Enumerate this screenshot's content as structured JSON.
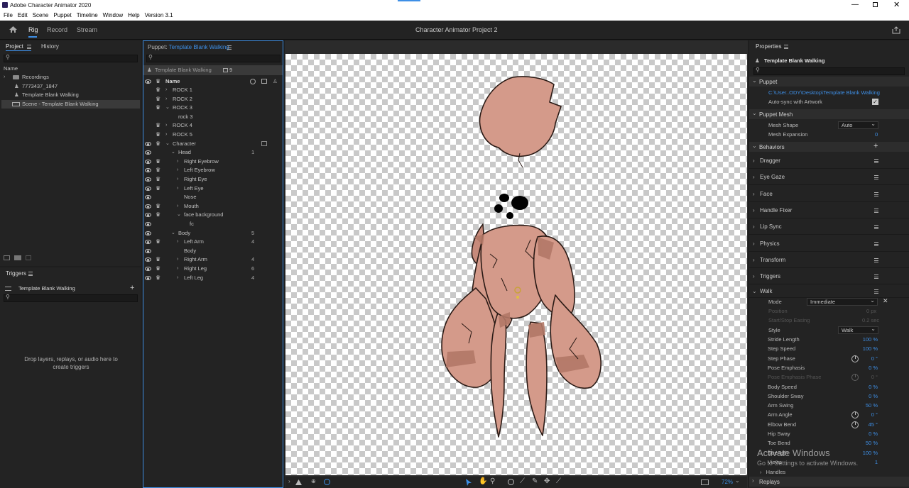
{
  "app": {
    "title": "Adobe Character Animator 2020",
    "project": "Character Animator Project 2"
  },
  "menu": [
    "File",
    "Edit",
    "Scene",
    "Puppet",
    "Timeline",
    "Window",
    "Help",
    "Version 3.1"
  ],
  "workspace": {
    "tabs": [
      "Rig",
      "Record",
      "Stream"
    ],
    "active": "Rig"
  },
  "project_panel": {
    "tabs": [
      "Project",
      "History"
    ],
    "column": "Name",
    "items": [
      "Recordings",
      "7773437_1847",
      "Template Blank Walking",
      "Scene - Template Blank Walking"
    ]
  },
  "triggers_panel": {
    "title": "Triggers",
    "puppet": "Template Blank Walking",
    "empty_text": "Drop layers, replays, or audio here to create triggers"
  },
  "puppet_panel": {
    "label": "Puppet:",
    "name": "Template Blank Walking",
    "puppet_row": "Template Blank Walking",
    "puppet_count": "9",
    "column": "Name",
    "layers": [
      {
        "name": "ROCK 1",
        "count": ""
      },
      {
        "name": "ROCK 2",
        "count": ""
      },
      {
        "name": "ROCK 3",
        "count": ""
      },
      {
        "name": "rock 3",
        "count": ""
      },
      {
        "name": "ROCK 4",
        "count": ""
      },
      {
        "name": "ROCK 5",
        "count": ""
      },
      {
        "name": "Character",
        "count": ""
      },
      {
        "name": "Head",
        "count": "1"
      },
      {
        "name": "Right Eyebrow",
        "count": ""
      },
      {
        "name": "Left Eyebrow",
        "count": ""
      },
      {
        "name": "Right Eye",
        "count": ""
      },
      {
        "name": "Left Eye",
        "count": ""
      },
      {
        "name": "Nose",
        "count": ""
      },
      {
        "name": "Mouth",
        "count": ""
      },
      {
        "name": "face background",
        "count": ""
      },
      {
        "name": "fc",
        "count": ""
      },
      {
        "name": "Body",
        "count": "5"
      },
      {
        "name": "Left Arm",
        "count": "4"
      },
      {
        "name": "Body",
        "count": ""
      },
      {
        "name": "Right Arm",
        "count": "4"
      },
      {
        "name": "Right Leg",
        "count": "6"
      },
      {
        "name": "Left Leg",
        "count": "4"
      }
    ]
  },
  "stage": {
    "zoom": "72%"
  },
  "properties": {
    "title": "Properties",
    "puppet_name": "Template Blank Walking",
    "puppet_section": "Puppet",
    "path": "C:\\User..ODY\\Desktop\\Template Blank Walking",
    "autosync_label": "Auto-sync with Artwork",
    "mesh_section": "Puppet Mesh",
    "mesh_shape_label": "Mesh Shape",
    "mesh_shape_value": "Auto",
    "mesh_expansion_label": "Mesh Expansion",
    "mesh_expansion_value": "0",
    "behaviors_label": "Behaviors",
    "behaviors": [
      "Dragger",
      "Eye Gaze",
      "Face",
      "Handle Fixer",
      "Lip Sync",
      "Physics",
      "Transform",
      "Triggers"
    ],
    "walk": {
      "title": "Walk",
      "mode_label": "Mode",
      "mode_value": "Immediate",
      "position_label": "Position",
      "position_value": "0 px",
      "easing_label": "Start/Stop Easing",
      "easing_value": "0.2 sec",
      "style_label": "Style",
      "style_value": "Walk",
      "params": [
        {
          "label": "Stride Length",
          "value": "100 %"
        },
        {
          "label": "Step Speed",
          "value": "100 %"
        },
        {
          "label": "Step Phase",
          "value": "0 °"
        },
        {
          "label": "Pose Emphasis",
          "value": "0 %"
        },
        {
          "label": "Pose Emphasis Phase",
          "value": "0 °"
        },
        {
          "label": "Body Speed",
          "value": "0 %"
        },
        {
          "label": "Shoulder Sway",
          "value": "0 %"
        },
        {
          "label": "Arm Swing",
          "value": "50 %"
        },
        {
          "label": "Arm Angle",
          "value": "0 °"
        },
        {
          "label": "Elbow Bend",
          "value": "45 °"
        },
        {
          "label": "Hip Sway",
          "value": "0 %"
        },
        {
          "label": "Toe Bend",
          "value": "50 %"
        },
        {
          "label": "Strength",
          "value": "100 %"
        },
        {
          "label": "Views",
          "value": "1"
        }
      ],
      "handles_label": "Handles",
      "replays_label": "Replays"
    }
  },
  "watermark": {
    "line1": "Activate Windows",
    "line2": "Go to Settings to activate Windows."
  }
}
